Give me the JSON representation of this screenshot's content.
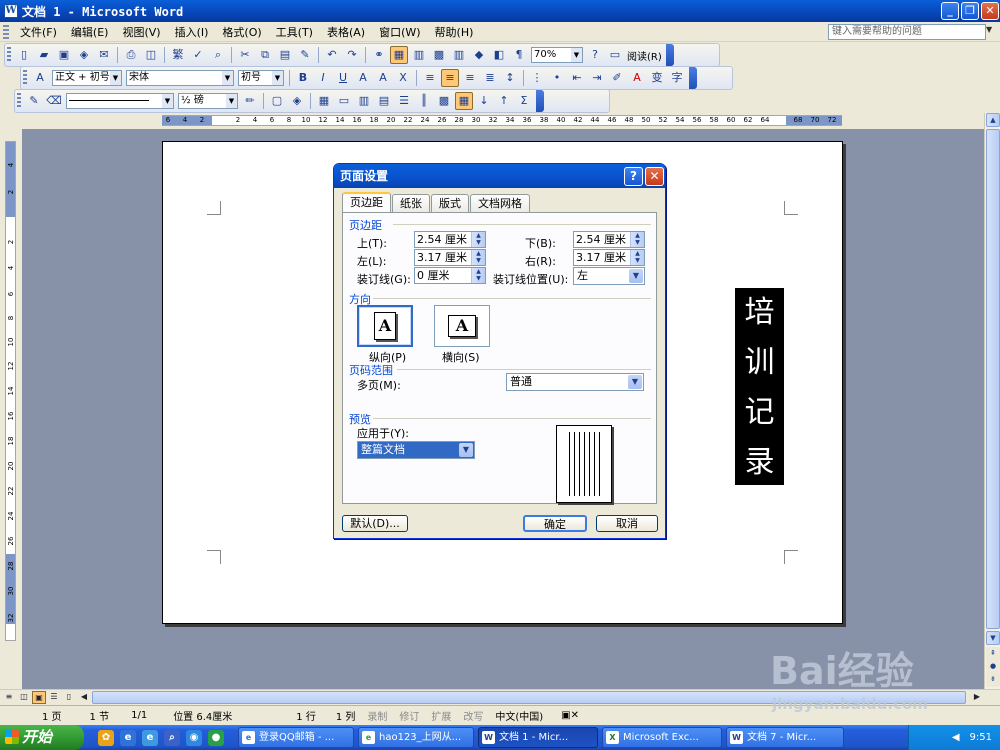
{
  "window": {
    "title": "文档 1 - Microsoft Word",
    "controls": [
      "_",
      "❐",
      "✕"
    ]
  },
  "menu": {
    "items": [
      "文件(F)",
      "编辑(E)",
      "视图(V)",
      "插入(I)",
      "格式(O)",
      "工具(T)",
      "表格(A)",
      "窗口(W)",
      "帮助(H)"
    ],
    "help_placeholder": "键入需要帮助的问题"
  },
  "toolbar1": {
    "zoom": "70%",
    "reading": "阅读(R)"
  },
  "toolbar2": {
    "style": "正文 + 初号",
    "font": "宋体",
    "size": "初号"
  },
  "toolbar3": {
    "line_weight": "½ 磅"
  },
  "ruler_top": [
    "6",
    "4",
    "2",
    "2",
    "4",
    "6",
    "8",
    "10",
    "12",
    "14",
    "16",
    "18",
    "20",
    "22",
    "24",
    "26",
    "28",
    "30",
    "32",
    "34",
    "36",
    "38",
    "40",
    "42",
    "44",
    "46",
    "48",
    "50",
    "52",
    "54",
    "56",
    "58",
    "60",
    "62",
    "64",
    "68",
    "70",
    "72"
  ],
  "ruler_left": [
    "4",
    "2",
    "2",
    "4",
    "6",
    "8",
    "10",
    "12",
    "14",
    "16",
    "18",
    "20",
    "22",
    "24",
    "26",
    "28",
    "30",
    "32"
  ],
  "document": {
    "vertical_text": [
      "培",
      "训",
      "记",
      "录"
    ]
  },
  "dialog": {
    "title": "页面设置",
    "help_btn": "?",
    "close_btn": "✕",
    "tabs": [
      "页边距",
      "纸张",
      "版式",
      "文档网格"
    ],
    "margins_group": "页边距",
    "top_label": "上(T):",
    "top_value": "2.54 厘米",
    "bottom_label": "下(B):",
    "bottom_value": "2.54 厘米",
    "left_label": "左(L):",
    "left_value": "3.17 厘米",
    "right_label": "右(R):",
    "right_value": "3.17 厘米",
    "gutter_label": "装订线(G):",
    "gutter_value": "0 厘米",
    "gutter_pos_label": "装订线位置(U):",
    "gutter_pos_value": "左",
    "orientation_group": "方向",
    "portrait_label": "纵向(P)",
    "landscape_label": "横向(S)",
    "orientation_glyph": "A",
    "pages_group": "页码范围",
    "multi_pages_label": "多页(M):",
    "multi_pages_value": "普通",
    "preview_group": "预览",
    "apply_label": "应用于(Y):",
    "apply_value": "整篇文档",
    "default_btn": "默认(D)...",
    "ok_btn": "确定",
    "cancel_btn": "取消"
  },
  "statusbar": {
    "page": "1 页",
    "section": "1 节",
    "pages": "1/1",
    "position": "位置 6.4厘米",
    "line": "1 行",
    "col": "1 列",
    "rec": "录制",
    "trk": "修订",
    "ext": "扩展",
    "ovr": "改写",
    "lang": "中文(中国)"
  },
  "taskbar": {
    "start": "开始",
    "tasks": [
      "登录QQ邮箱 - ...",
      "hao123_上网从...",
      "文档 1 - Micr...",
      "Microsoft Exc...",
      "文档 7 - Micr..."
    ],
    "clock": "9:51"
  },
  "watermark": {
    "main": "Bai经验",
    "sub": "jingyan.baidu.com"
  },
  "colors": {
    "titlebar": "#0a5fd8",
    "group_label": "#0046d5",
    "doc_bg": "#8791a8",
    "start": "#2e962e"
  }
}
